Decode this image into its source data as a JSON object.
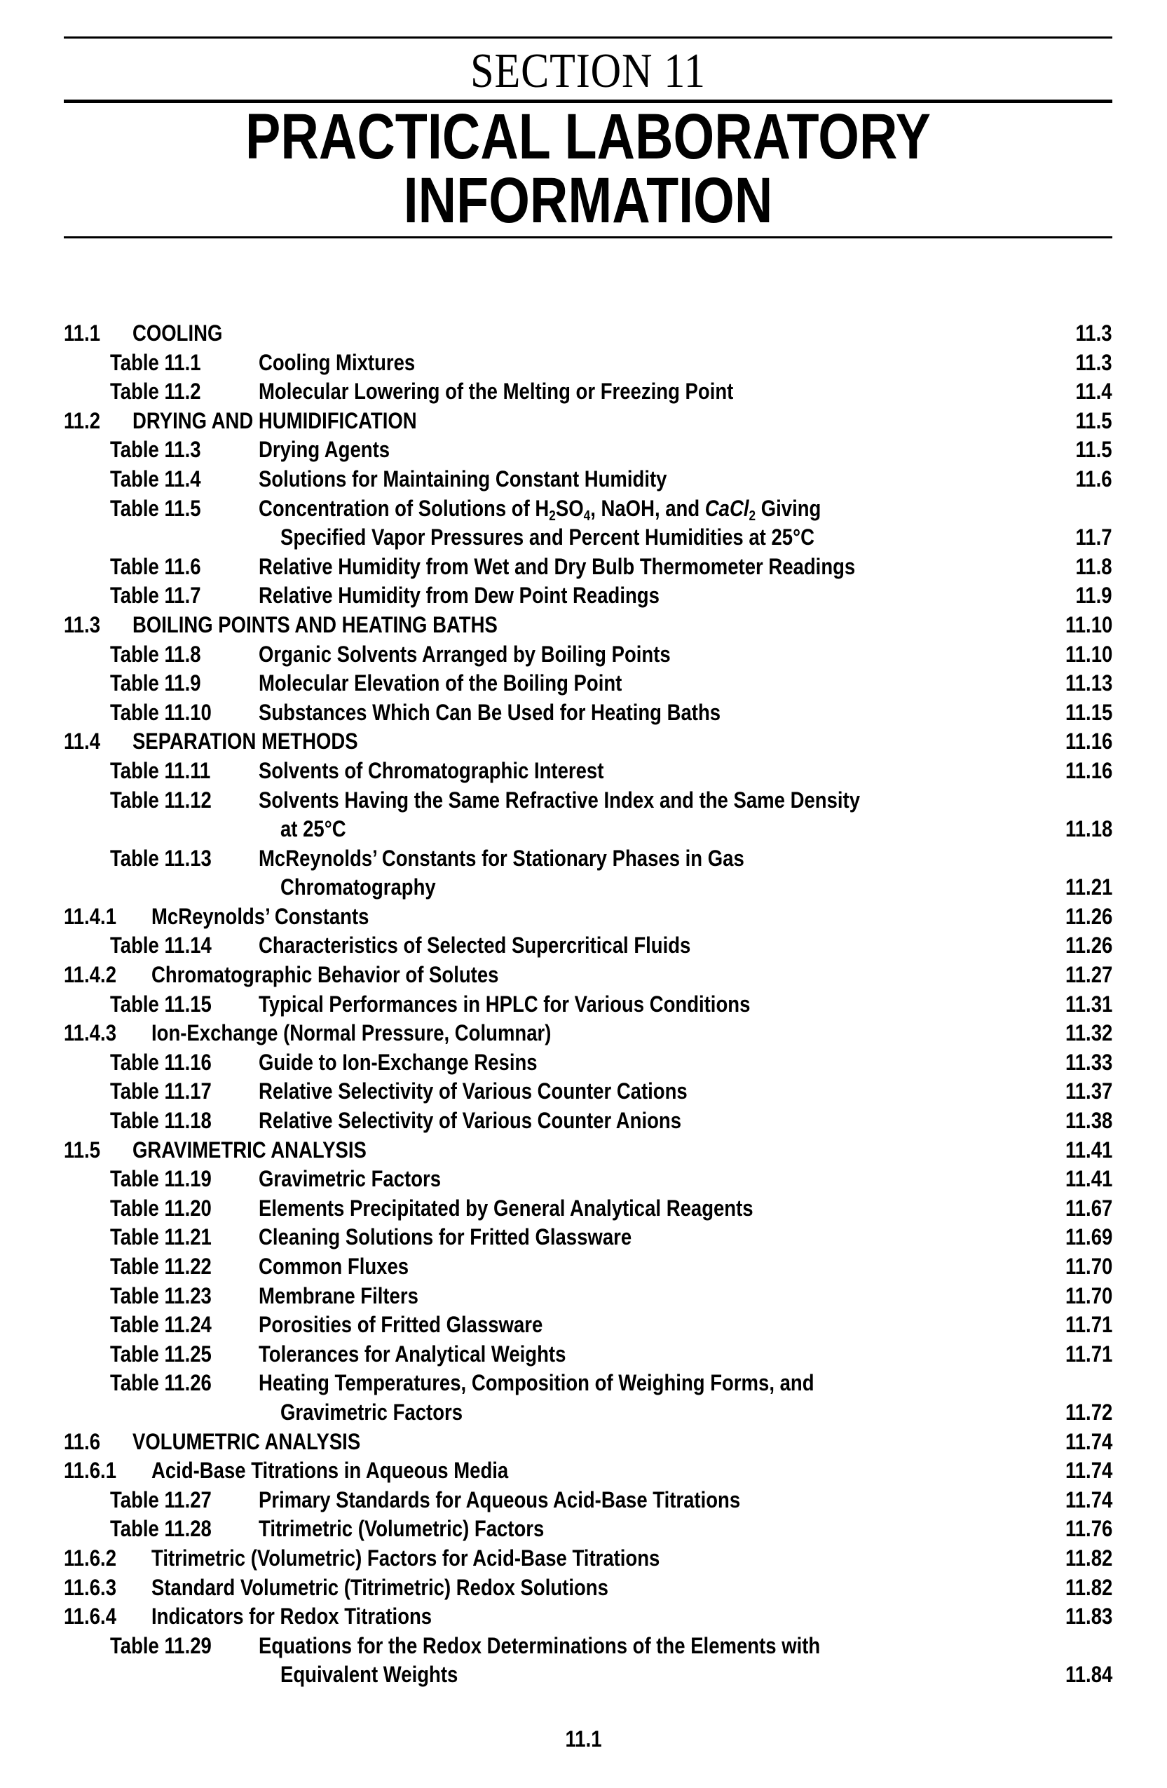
{
  "header": {
    "section_label": "SECTION 11",
    "title": "PRACTICAL LABORATORY INFORMATION",
    "title_line1": "PRACTICAL LABORATORY",
    "title_line2": "INFORMATION"
  },
  "toc": [
    {
      "type": "sec",
      "num": "11.1",
      "title": "COOLING",
      "page": "11.3"
    },
    {
      "type": "tbl",
      "num": "Table 11.1",
      "title": "Cooling Mixtures",
      "page": "11.3"
    },
    {
      "type": "tbl",
      "num": "Table 11.2",
      "title": "Molecular Lowering of the Melting or Freezing Point",
      "page": "11.4"
    },
    {
      "type": "sec",
      "num": "11.2",
      "title": "DRYING AND HUMIDIFICATION",
      "page": "11.5"
    },
    {
      "type": "tbl",
      "num": "Table 11.3",
      "title": "Drying Agents",
      "page": "11.5"
    },
    {
      "type": "tbl",
      "num": "Table 11.4",
      "title": "Solutions for Maintaining Constant Humidity",
      "page": "11.6"
    },
    {
      "type": "tbl",
      "num": "Table 11.5",
      "title_parts": [
        "Concentration of Solutions of H",
        "2",
        "SO",
        "4",
        ", NaOH, and ",
        "CaCl",
        "2",
        " Giving"
      ],
      "title": "Concentration of Solutions of H2SO4, NaOH, and CaCl2 Giving",
      "page": ""
    },
    {
      "type": "cont",
      "num": "",
      "title": "Specified Vapor Pressures and Percent Humidities at 25°C",
      "page": "11.7"
    },
    {
      "type": "tbl",
      "num": "Table 11.6",
      "title": "Relative Humidity from Wet and Dry Bulb Thermometer Readings",
      "page": "11.8"
    },
    {
      "type": "tbl",
      "num": "Table 11.7",
      "title": "Relative Humidity from Dew Point Readings",
      "page": "11.9"
    },
    {
      "type": "sec",
      "num": "11.3",
      "title": "BOILING POINTS AND HEATING BATHS",
      "page": "11.10"
    },
    {
      "type": "tbl",
      "num": "Table 11.8",
      "title": "Organic Solvents Arranged by Boiling Points",
      "page": "11.10"
    },
    {
      "type": "tbl",
      "num": "Table 11.9",
      "title": "Molecular Elevation of the Boiling Point",
      "page": "11.13"
    },
    {
      "type": "tbl",
      "num": "Table 11.10",
      "title": "Substances Which Can Be Used for Heating Baths",
      "page": "11.15"
    },
    {
      "type": "sec",
      "num": "11.4",
      "title": "SEPARATION METHODS",
      "page": "11.16"
    },
    {
      "type": "tbl",
      "num": "Table 11.11",
      "title": "Solvents of Chromatographic Interest",
      "page": "11.16"
    },
    {
      "type": "tbl",
      "num": "Table 11.12",
      "title": "Solvents Having the Same Refractive Index and the Same Density",
      "page": ""
    },
    {
      "type": "cont",
      "num": "",
      "title": "at 25°C",
      "page": "11.18"
    },
    {
      "type": "tbl",
      "num": "Table 11.13",
      "title": "McReynolds’ Constants for Stationary Phases in Gas",
      "page": ""
    },
    {
      "type": "cont",
      "num": "",
      "title": "Chromatography",
      "page": "11.21"
    },
    {
      "type": "sub",
      "num": "11.4.1",
      "title": "McReynolds’ Constants",
      "page": "11.26"
    },
    {
      "type": "tbl",
      "num": "Table 11.14",
      "title": "Characteristics of Selected Supercritical Fluids",
      "page": "11.26"
    },
    {
      "type": "sub",
      "num": "11.4.2",
      "title": "Chromatographic Behavior of Solutes",
      "page": "11.27"
    },
    {
      "type": "tbl",
      "num": "Table 11.15",
      "title": "Typical Performances in HPLC for Various Conditions",
      "page": "11.31"
    },
    {
      "type": "sub",
      "num": "11.4.3",
      "title": "Ion-Exchange (Normal Pressure, Columnar)",
      "page": "11.32"
    },
    {
      "type": "tbl",
      "num": "Table 11.16",
      "title": "Guide to Ion-Exchange Resins",
      "page": "11.33"
    },
    {
      "type": "tbl",
      "num": "Table 11.17",
      "title": "Relative Selectivity of Various Counter Cations",
      "page": "11.37"
    },
    {
      "type": "tbl",
      "num": "Table 11.18",
      "title": "Relative Selectivity of Various Counter Anions",
      "page": "11.38"
    },
    {
      "type": "sec",
      "num": "11.5",
      "title": "GRAVIMETRIC ANALYSIS",
      "page": "11.41"
    },
    {
      "type": "tbl",
      "num": "Table 11.19",
      "title": "Gravimetric Factors",
      "page": "11.41"
    },
    {
      "type": "tbl",
      "num": "Table 11.20",
      "title": "Elements Precipitated by General Analytical Reagents",
      "page": "11.67"
    },
    {
      "type": "tbl",
      "num": "Table 11.21",
      "title": "Cleaning Solutions for Fritted Glassware",
      "page": "11.69"
    },
    {
      "type": "tbl",
      "num": "Table 11.22",
      "title": "Common Fluxes",
      "page": "11.70"
    },
    {
      "type": "tbl",
      "num": "Table 11.23",
      "title": "Membrane Filters",
      "page": "11.70"
    },
    {
      "type": "tbl",
      "num": "Table 11.24",
      "title": "Porosities of Fritted Glassware",
      "page": "11.71"
    },
    {
      "type": "tbl",
      "num": "Table 11.25",
      "title": "Tolerances for Analytical Weights",
      "page": "11.71"
    },
    {
      "type": "tbl",
      "num": "Table 11.26",
      "title": "Heating Temperatures, Composition of Weighing Forms, and",
      "page": ""
    },
    {
      "type": "cont",
      "num": "",
      "title": "Gravimetric Factors",
      "page": "11.72"
    },
    {
      "type": "sec",
      "num": "11.6",
      "title": "VOLUMETRIC ANALYSIS",
      "page": "11.74"
    },
    {
      "type": "sub",
      "num": "11.6.1",
      "title": "Acid-Base Titrations in Aqueous Media",
      "page": "11.74"
    },
    {
      "type": "tbl",
      "num": "Table 11.27",
      "title": "Primary Standards for Aqueous Acid-Base Titrations",
      "page": "11.74"
    },
    {
      "type": "tbl",
      "num": "Table 11.28",
      "title": "Titrimetric (Volumetric) Factors",
      "page": "11.76"
    },
    {
      "type": "sub",
      "num": "11.6.2",
      "title": "Titrimetric (Volumetric) Factors for Acid-Base Titrations",
      "page": "11.82"
    },
    {
      "type": "sub",
      "num": "11.6.3",
      "title": "Standard Volumetric (Titrimetric) Redox Solutions",
      "page": "11.82"
    },
    {
      "type": "sub",
      "num": "11.6.4",
      "title": "Indicators for Redox Titrations",
      "page": "11.83"
    },
    {
      "type": "tbl",
      "num": "Table 11.29",
      "title": "Equations for the Redox Determinations of the Elements with",
      "page": ""
    },
    {
      "type": "cont",
      "num": "",
      "title": "Equivalent Weights",
      "page": "11.84"
    }
  ],
  "footer": {
    "page_number": "11.1"
  }
}
